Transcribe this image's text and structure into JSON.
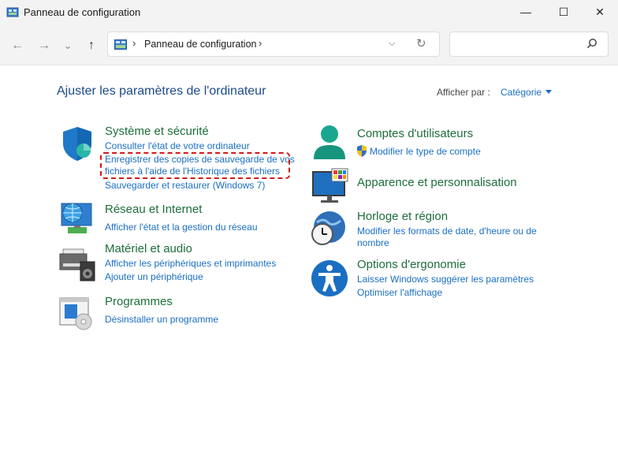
{
  "window": {
    "title": "Panneau de configuration",
    "minimize_glyph": "—",
    "maximize_glyph": "☐",
    "close_glyph": "✕"
  },
  "nav": {
    "back_glyph": "←",
    "forward_glyph": "→",
    "recent_glyph": "⌄",
    "up_glyph": "↑",
    "address_separator": "›",
    "address_text": "Panneau de configuration",
    "address_dropdown_glyph": "⌵",
    "refresh_glyph": "↻",
    "search_placeholder": "",
    "search_icon": "search-icon"
  },
  "header": {
    "title": "Ajuster les paramètres de l'ordinateur",
    "view_by_label": "Afficher par :",
    "view_by_value": "Catégorie"
  },
  "categories": {
    "system": {
      "title": "Système et sécurité",
      "links": [
        "Consulter l'état de votre ordinateur",
        "Enregistrer des copies de sauvegarde de vos fichiers à l'aide de l'Historique des fichiers",
        "Sauvegarder et restaurer (Windows 7)"
      ],
      "link_2_line_1": "Enregistrer des copies de sauvegarde de vos",
      "link_2_line_2": "fichiers à l'aide de l'Historique des fichiers"
    },
    "network": {
      "title": "Réseau et Internet",
      "links": [
        "Afficher l'état et la gestion du réseau"
      ]
    },
    "hardware": {
      "title": "Matériel et audio",
      "links": [
        "Afficher les périphériques et imprimantes",
        "Ajouter un périphérique"
      ]
    },
    "programs": {
      "title": "Programmes",
      "links": [
        "Désinstaller un programme"
      ]
    },
    "accounts": {
      "title": "Comptes d'utilisateurs",
      "links": [
        "Modifier le type de compte"
      ]
    },
    "appearance": {
      "title": "Apparence et personnalisation",
      "links": []
    },
    "clock": {
      "title": "Horloge et région",
      "links": [
        "Modifier les formats de date, d'heure ou de nombre"
      ],
      "link_1_line_1": "Modifier les formats de date, d'heure ou de",
      "link_1_line_2": "nombre"
    },
    "ease": {
      "title": "Options d'ergonomie",
      "links": [
        "Laisser Windows suggérer les paramètres",
        "Optimiser l'affichage"
      ]
    }
  },
  "colors": {
    "accent": "#1a6fc2",
    "category_title": "#1d6e3a",
    "highlight": "#d11a1a"
  }
}
